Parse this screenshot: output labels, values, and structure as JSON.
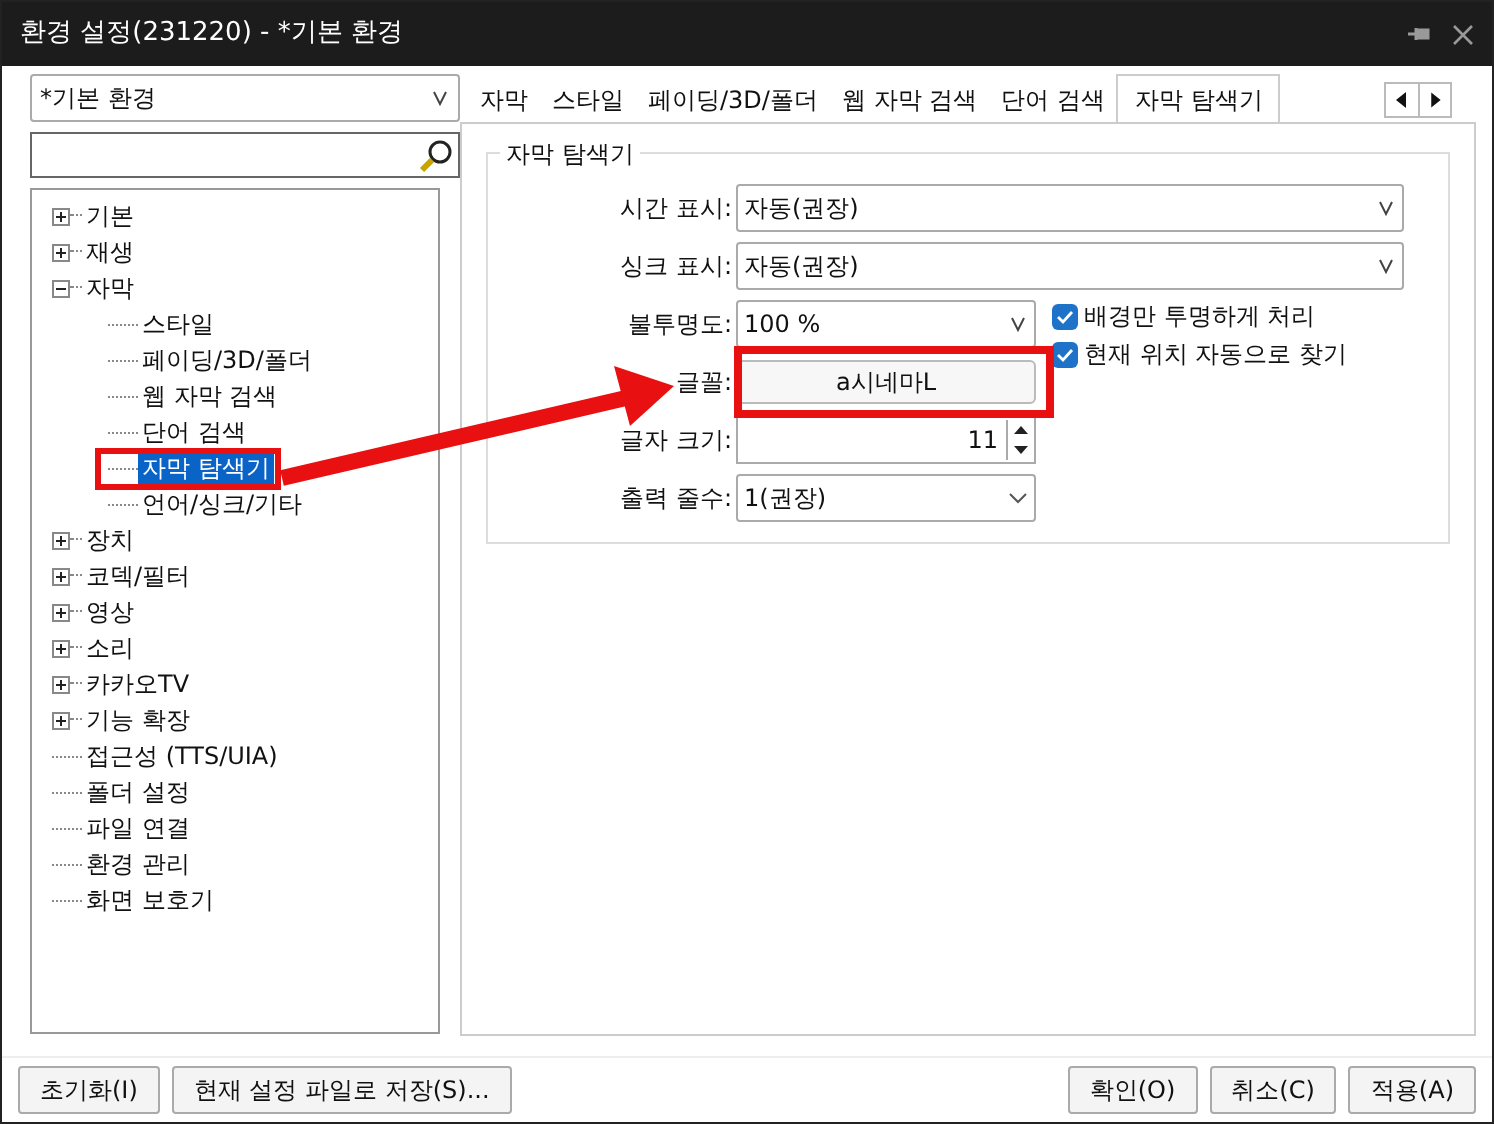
{
  "window": {
    "title": "환경 설정(231220) - *기본 환경"
  },
  "profile_select": {
    "value": "*기본 환경"
  },
  "tree": [
    {
      "label": "기본",
      "expanded": false,
      "selected": false
    },
    {
      "label": "재생",
      "expanded": false,
      "selected": false
    },
    {
      "label": "자막",
      "expanded": true,
      "selected": false,
      "children": [
        {
          "label": "스타일",
          "selected": false
        },
        {
          "label": "페이딩/3D/폴더",
          "selected": false
        },
        {
          "label": "웹 자막 검색",
          "selected": false
        },
        {
          "label": "단어 검색",
          "selected": false
        },
        {
          "label": "자막 탐색기",
          "selected": true
        },
        {
          "label": "언어/싱크/기타",
          "selected": false
        }
      ]
    },
    {
      "label": "장치",
      "expanded": false,
      "selected": false
    },
    {
      "label": "코덱/필터",
      "expanded": false,
      "selected": false
    },
    {
      "label": "영상",
      "expanded": false,
      "selected": false
    },
    {
      "label": "소리",
      "expanded": false,
      "selected": false
    },
    {
      "label": "카카오TV",
      "expanded": false,
      "selected": false
    },
    {
      "label": "기능 확장",
      "expanded": false,
      "selected": false
    },
    {
      "label": "접근성 (TTS/UIA)",
      "selected": false
    },
    {
      "label": "폴더 설정",
      "selected": false
    },
    {
      "label": "파일 연결",
      "selected": false
    },
    {
      "label": "환경 관리",
      "selected": false
    },
    {
      "label": "화면 보호기",
      "selected": false
    }
  ],
  "tabs": [
    {
      "label": "자막",
      "selected": false
    },
    {
      "label": "스타일",
      "selected": false
    },
    {
      "label": "페이딩/3D/폴더",
      "selected": false
    },
    {
      "label": "웹 자막 검색",
      "selected": false
    },
    {
      "label": "단어 검색",
      "selected": false
    },
    {
      "label": "자막 탐색기",
      "selected": true
    }
  ],
  "group": {
    "title": "자막 탐색기",
    "fields": [
      {
        "kind": "select",
        "label": "시간 표시:",
        "value": "자동(권장)",
        "wide": true
      },
      {
        "kind": "select",
        "label": "싱크 표시:",
        "value": "자동(권장)",
        "wide": true
      },
      {
        "kind": "select",
        "label": "불투명도:",
        "value": "100 %",
        "wide": false
      },
      {
        "kind": "button",
        "label": "글꼴:",
        "value": "a시네마L",
        "wide": false
      },
      {
        "kind": "spin",
        "label": "글자 크기:",
        "value": "11",
        "wide": false
      },
      {
        "kind": "select",
        "label": "출력 줄수:",
        "value": "1(권장)",
        "wide": false,
        "chevron": true
      }
    ],
    "checkboxes": [
      {
        "label": "배경만 투명하게 처리",
        "checked": true
      },
      {
        "label": "현재 위치 자동으로 찾기",
        "checked": true
      }
    ]
  },
  "buttons_left": [
    {
      "label": "초기화(I)"
    },
    {
      "label": "현재 설정 파일로 저장(S)..."
    }
  ],
  "buttons_right": [
    {
      "label": "확인(O)"
    },
    {
      "label": "취소(C)"
    },
    {
      "label": "적용(A)"
    }
  ]
}
